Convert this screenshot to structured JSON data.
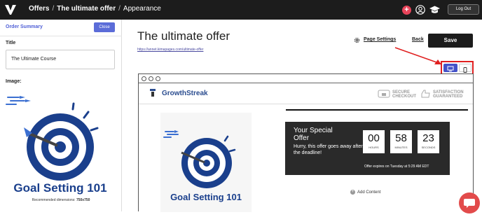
{
  "topbar": {
    "breadcrumbs": [
      "Offers",
      "The ultimate offer",
      "Appearance"
    ],
    "plus_symbol": "+",
    "logout_label": "Log Out",
    "icons": [
      "logo-icon",
      "plus-icon",
      "user-icon",
      "graduation-cap-icon"
    ],
    "colors": {
      "bar": "#1c1c1c",
      "plus": "#e8445a"
    }
  },
  "sidebar": {
    "header_title": "Order Summary",
    "close_label": "Close",
    "title_label": "Title",
    "title_value": "The Ultimate Course",
    "image_label": "Image:",
    "image_text": "Goal Setting 101",
    "recommended_prefix": "Recommended dimensions:",
    "recommended_value": "750x750"
  },
  "main": {
    "heading": "The ultimate offer",
    "url": "https://annet.kimapages.com/ultimate-offer",
    "page_settings_label": "Page Settings",
    "back_label": "Back",
    "save_label": "Save",
    "view_toggle": {
      "selected": "desktop",
      "options": [
        "desktop-icon",
        "mobile-icon"
      ],
      "accent": "#4452c8",
      "highlight": "#e02020"
    }
  },
  "preview": {
    "brand_name": "GrowthStreak",
    "badge_secure": [
      "SECURE",
      "CHECKOUT"
    ],
    "badge_satisfaction": [
      "SATISFACTION",
      "GUARANTEED"
    ],
    "product_image_text": "Goal Setting 101",
    "offer_title": [
      "Your Special",
      "Offer"
    ],
    "offer_subtitle": "Hurry, this offer goes away after the deadline!",
    "countdown": [
      {
        "value": "00",
        "label": "HOURS"
      },
      {
        "value": "58",
        "label": "MINUTES"
      },
      {
        "value": "23",
        "label": "SECONDS"
      }
    ],
    "expires_text": "Offer expires on Tuesday at 5:29 AM EDT",
    "add_content_label": "Add Content",
    "add_symbol": "+"
  }
}
